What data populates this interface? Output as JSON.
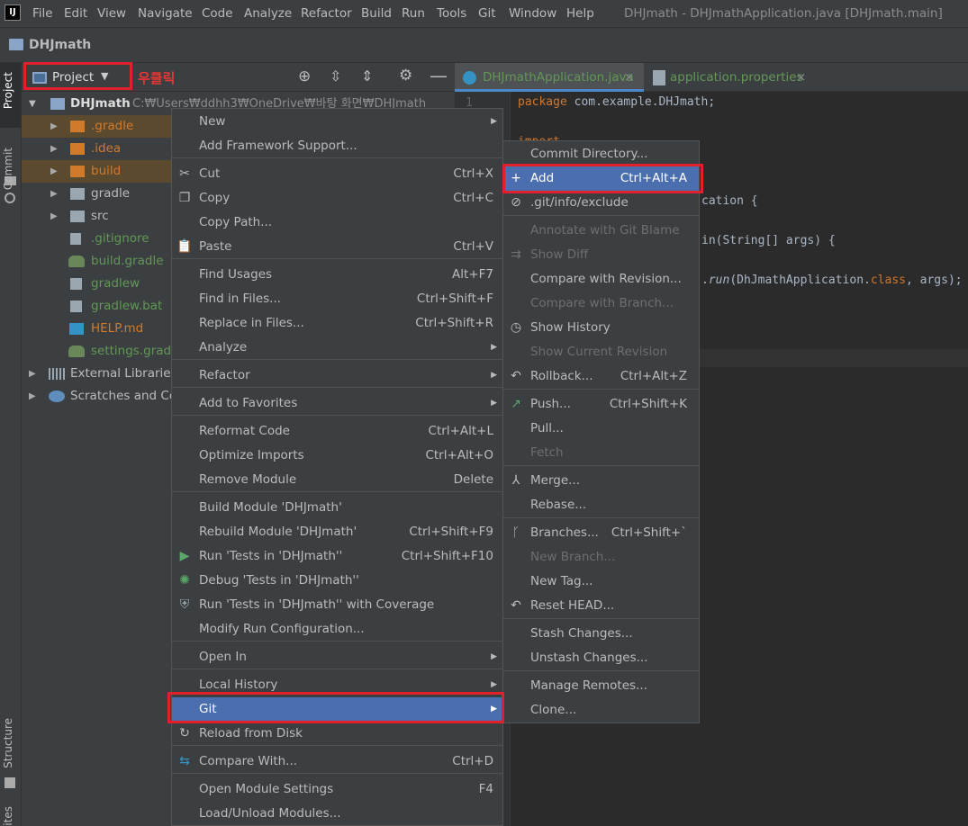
{
  "app": {
    "icon_label": "IJ",
    "window_title": "DHJmath - DHJmathApplication.java [DHJmath.main]"
  },
  "menubar": [
    {
      "label": "File"
    },
    {
      "label": "Edit"
    },
    {
      "label": "View"
    },
    {
      "label": "Navigate"
    },
    {
      "label": "Code"
    },
    {
      "label": "Analyze"
    },
    {
      "label": "Refactor"
    },
    {
      "label": "Build"
    },
    {
      "label": "Run"
    },
    {
      "label": "Tools"
    },
    {
      "label": "Git"
    },
    {
      "label": "Window"
    },
    {
      "label": "Help"
    }
  ],
  "navbar": {
    "project": "DHJmath"
  },
  "left_toolbar": {
    "project": "Project",
    "commit": "Commit",
    "structure": "Structure",
    "bottom": "ites"
  },
  "project_panel": {
    "selector": "Project",
    "annotation": "우클릭"
  },
  "tree": [
    {
      "label": "DHJmath",
      "path": "C:₩Users₩ddhh3₩OneDrive₩바탕 화면₩DHJmath"
    },
    {
      "label": ".gradle"
    },
    {
      "label": ".idea"
    },
    {
      "label": "build"
    },
    {
      "label": "gradle"
    },
    {
      "label": "src"
    },
    {
      "label": ".gitignore"
    },
    {
      "label": "build.gradle"
    },
    {
      "label": "gradlew"
    },
    {
      "label": "gradlew.bat"
    },
    {
      "label": "HELP.md"
    },
    {
      "label": "settings.gradle"
    },
    {
      "label": "External Libraries"
    },
    {
      "label": "Scratches and Consoles"
    }
  ],
  "editor_tabs": [
    {
      "label": "DHJmathApplication.java"
    },
    {
      "label": "application.properties"
    }
  ],
  "code": {
    "line_number": "1",
    "l1_kw": "package",
    "l1_rest": " com.example.DHJmath;",
    "l3": "import",
    "l5": "cation {",
    "l7": "in(String[] args) {",
    "l9_run": "run",
    "l9_mid": "(DhJmathApplication.",
    "l9_class": "class",
    "l9_end": ", args);"
  },
  "context_menu": [
    {
      "label": "New",
      "shortcut": "",
      "submenu": true
    },
    {
      "label": "Add Framework Support...",
      "shortcut": ""
    },
    {
      "label": "Cut",
      "shortcut": "Ctrl+X"
    },
    {
      "label": "Copy",
      "shortcut": "Ctrl+C"
    },
    {
      "label": "Copy Path...",
      "shortcut": ""
    },
    {
      "label": "Paste",
      "shortcut": "Ctrl+V"
    },
    {
      "label": "Find Usages",
      "shortcut": "Alt+F7"
    },
    {
      "label": "Find in Files...",
      "shortcut": "Ctrl+Shift+F"
    },
    {
      "label": "Replace in Files...",
      "shortcut": "Ctrl+Shift+R"
    },
    {
      "label": "Analyze",
      "shortcut": "",
      "submenu": true
    },
    {
      "label": "Refactor",
      "shortcut": "",
      "submenu": true
    },
    {
      "label": "Add to Favorites",
      "shortcut": "",
      "submenu": true
    },
    {
      "label": "Reformat Code",
      "shortcut": "Ctrl+Alt+L"
    },
    {
      "label": "Optimize Imports",
      "shortcut": "Ctrl+Alt+O"
    },
    {
      "label": "Remove Module",
      "shortcut": "Delete"
    },
    {
      "label": "Build Module 'DHJmath'",
      "shortcut": ""
    },
    {
      "label": "Rebuild Module 'DHJmath'",
      "shortcut": "Ctrl+Shift+F9"
    },
    {
      "label": "Run 'Tests in 'DHJmath''",
      "shortcut": "Ctrl+Shift+F10"
    },
    {
      "label": "Debug 'Tests in 'DHJmath''",
      "shortcut": ""
    },
    {
      "label": "Run 'Tests in 'DHJmath'' with Coverage",
      "shortcut": ""
    },
    {
      "label": "Modify Run Configuration...",
      "shortcut": ""
    },
    {
      "label": "Open In",
      "shortcut": "",
      "submenu": true
    },
    {
      "label": "Local History",
      "shortcut": "",
      "submenu": true
    },
    {
      "label": "Git",
      "shortcut": "",
      "submenu": true,
      "selected": true
    },
    {
      "label": "Reload from Disk",
      "shortcut": ""
    },
    {
      "label": "Compare With...",
      "shortcut": "Ctrl+D"
    },
    {
      "label": "Open Module Settings",
      "shortcut": "F4"
    },
    {
      "label": "Load/Unload Modules...",
      "shortcut": ""
    }
  ],
  "git_menu": [
    {
      "label": "Commit Directory...",
      "shortcut": ""
    },
    {
      "label": "Add",
      "shortcut": "Ctrl+Alt+A",
      "selected": true
    },
    {
      "label": ".git/info/exclude",
      "shortcut": ""
    },
    {
      "label": "Annotate with Git Blame",
      "shortcut": "",
      "disabled": true
    },
    {
      "label": "Show Diff",
      "shortcut": "",
      "disabled": true
    },
    {
      "label": "Compare with Revision...",
      "shortcut": ""
    },
    {
      "label": "Compare with Branch...",
      "shortcut": "",
      "disabled": true
    },
    {
      "label": "Show History",
      "shortcut": ""
    },
    {
      "label": "Show Current Revision",
      "shortcut": "",
      "disabled": true
    },
    {
      "label": "Rollback...",
      "shortcut": "Ctrl+Alt+Z"
    },
    {
      "label": "Push...",
      "shortcut": "Ctrl+Shift+K"
    },
    {
      "label": "Pull...",
      "shortcut": ""
    },
    {
      "label": "Fetch",
      "shortcut": "",
      "disabled": true
    },
    {
      "label": "Merge...",
      "shortcut": ""
    },
    {
      "label": "Rebase...",
      "shortcut": ""
    },
    {
      "label": "Branches...",
      "shortcut": "Ctrl+Shift+`"
    },
    {
      "label": "New Branch...",
      "shortcut": "",
      "disabled": true
    },
    {
      "label": "New Tag...",
      "shortcut": ""
    },
    {
      "label": "Reset HEAD...",
      "shortcut": ""
    },
    {
      "label": "Stash Changes...",
      "shortcut": ""
    },
    {
      "label": "Unstash Changes...",
      "shortcut": ""
    },
    {
      "label": "Manage Remotes...",
      "shortcut": ""
    },
    {
      "label": "Clone...",
      "shortcut": ""
    }
  ],
  "colors": {
    "accent": "#4b6eaf",
    "highlight_box": "#e0202a",
    "folder_excluded": "#d07a2c",
    "vcs_added": "#629755"
  }
}
